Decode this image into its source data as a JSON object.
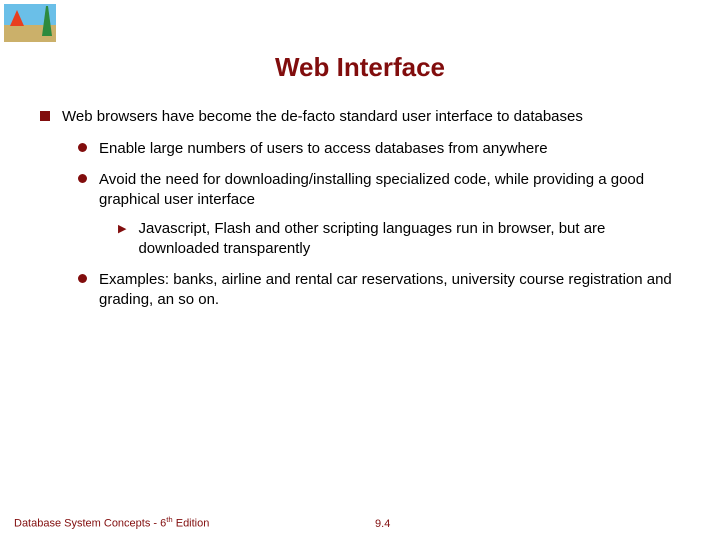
{
  "title": "Web Interface",
  "bullets": {
    "l1_1": "Web browsers have become the de-facto standard user interface to databases",
    "l2_1": "Enable large numbers of users to access databases from anywhere",
    "l2_2": "Avoid the need for downloading/installing specialized code, while providing a good graphical user interface",
    "l3_1": "Javascript, Flash and other scripting languages run in browser, but are downloaded transparently",
    "l2_3": "Examples: banks, airline and rental car reservations, university course registration and grading, an so on."
  },
  "footer": {
    "left_prefix": "Database System Concepts - 6",
    "left_suffix": " Edition",
    "left_sup": "th",
    "center": "9.4"
  }
}
